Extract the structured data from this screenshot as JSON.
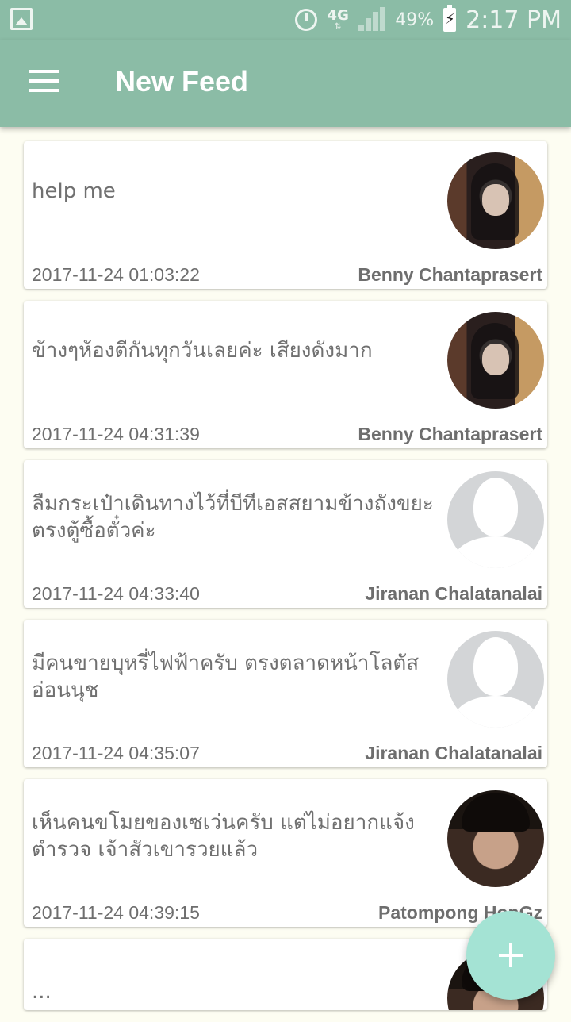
{
  "status_bar": {
    "gallery_icon": "image-icon",
    "alarm_icon": "alarm-clock-icon",
    "network_type": "4G",
    "signal_icon": "cell-signal-icon",
    "battery_percent": "49%",
    "battery_icon": "battery-charging-icon",
    "time": "2:17 PM"
  },
  "app_bar": {
    "menu_icon": "hamburger-menu-icon",
    "title": "New Feed"
  },
  "feed": {
    "items": [
      {
        "message": "help me",
        "timestamp": "2017-11-24 01:03:22",
        "author": "Benny Chantaprasert",
        "avatar": "user-photo"
      },
      {
        "message": "ข้างๆห้องตีกันทุกวันเลยค่ะ เสียงดังมาก",
        "timestamp": "2017-11-24 04:31:39",
        "author": "Benny Chantaprasert",
        "avatar": "user-photo"
      },
      {
        "message": "ลืมกระเป๋าเดินทางไว้ที่บีทีเอสสยามข้างถังขยะตรงตู้ซื้อตั๋วค่ะ",
        "timestamp": "2017-11-24 04:33:40",
        "author": "Jiranan Chalatanalai",
        "avatar": "default-avatar"
      },
      {
        "message": "มีคนขายบุหรี่ไฟฟ้าครับ ตรงตลาดหน้าโลตัส อ่อนนุช",
        "timestamp": "2017-11-24 04:35:07",
        "author": "Jiranan Chalatanalai",
        "avatar": "default-avatar"
      },
      {
        "message": "เห็นคนขโมยของเซเว่นครับ แต่ไม่อยากแจ้งตำรวจ เจ้าสัวเขารวยแล้ว",
        "timestamp": "2017-11-24 04:39:15",
        "author": "Patompong HonGz",
        "avatar": "user-photo"
      },
      {
        "message": "...",
        "timestamp": "",
        "author": "",
        "avatar": "user-photo"
      }
    ]
  },
  "fab": {
    "icon": "plus-icon"
  },
  "colors": {
    "primary": "#8bbca6",
    "fab": "#a4e3d4",
    "background": "#fdfdf2"
  }
}
